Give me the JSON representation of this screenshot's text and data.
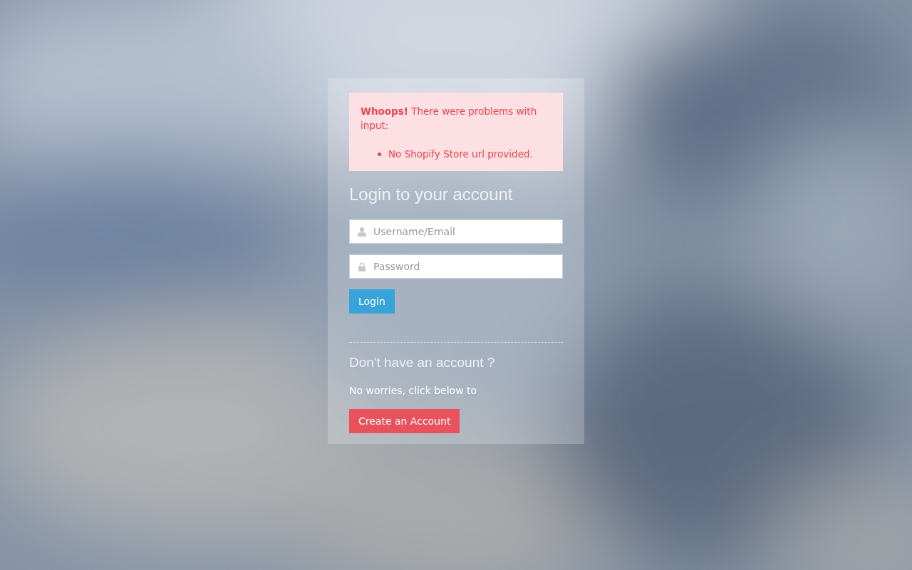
{
  "alert": {
    "message": "**Whoops!** There were problems with input:",
    "errors": [
      "No Shopify Store url provided."
    ]
  },
  "login": {
    "title": "Login to your account",
    "fields": [
      {
        "kind": "user",
        "placeholder": "Username/Email"
      },
      {
        "kind": "password",
        "placeholder": "Password"
      }
    ],
    "button": "Login"
  },
  "register": {
    "title": "Don't have an account ?",
    "text": "No worries, click below to",
    "button": "Create an Account"
  }
}
